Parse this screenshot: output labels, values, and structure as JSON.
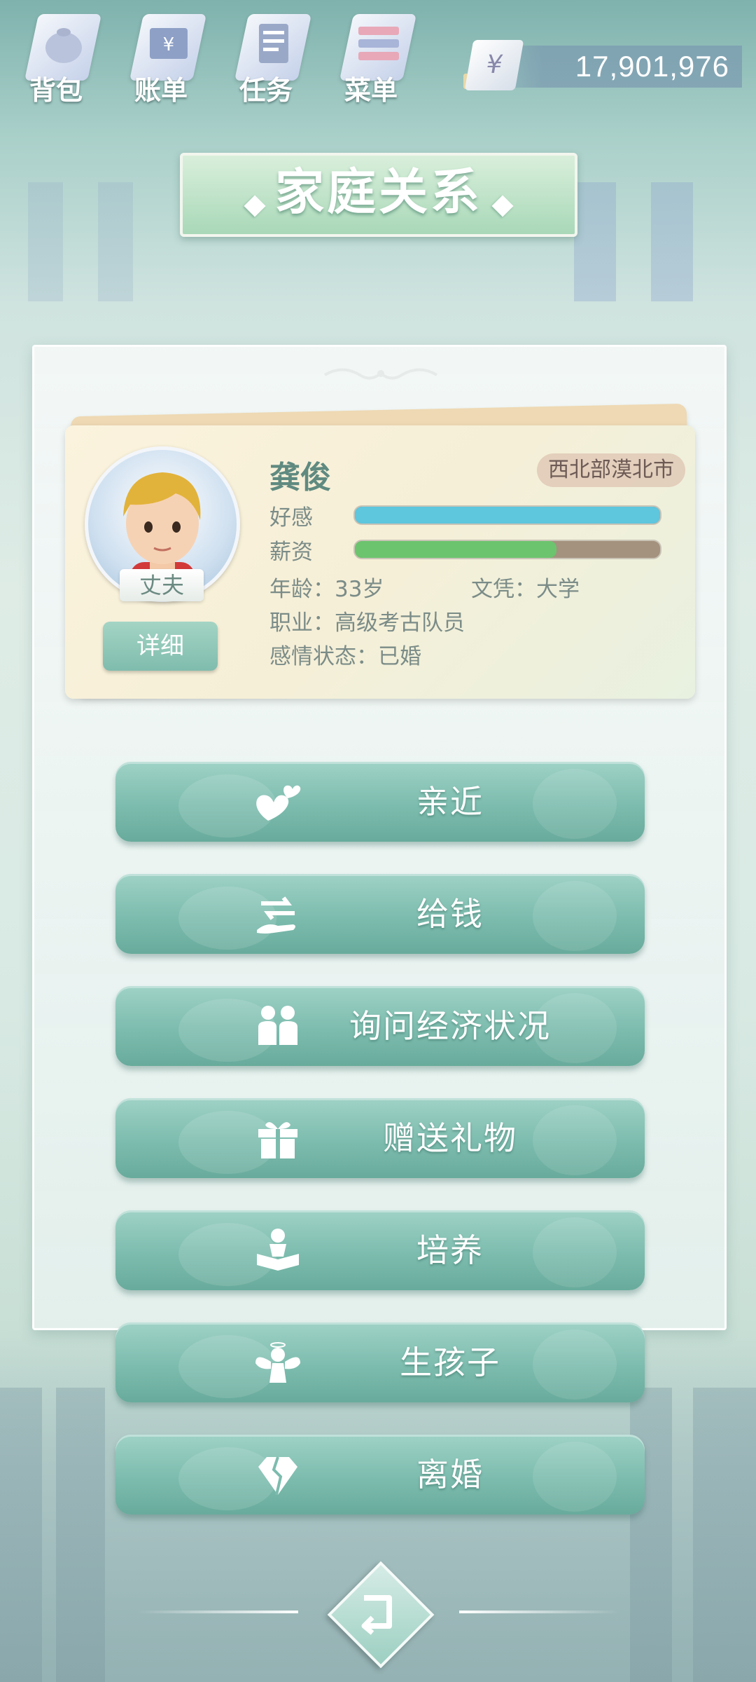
{
  "topbar": {
    "items": [
      {
        "label": "背包",
        "icon": "backpack-icon"
      },
      {
        "label": "账单",
        "icon": "bill-icon"
      },
      {
        "label": "任务",
        "icon": "task-icon"
      },
      {
        "label": "菜单",
        "icon": "menu-icon"
      }
    ],
    "currency_symbol": "¥",
    "money": "17,901,976"
  },
  "title": "家庭关系",
  "profile": {
    "name": "龚俊",
    "location": "西北部漠北市",
    "role": "丈夫",
    "detail_label": "详细",
    "affection_label": "好感",
    "affection_value": 1.0,
    "salary_label": "薪资",
    "salary_value": 0.66,
    "age": "年龄：33岁",
    "education": "文凭：大学",
    "occupation": "职业：高级考古队员",
    "relationship": "感情状态：已婚"
  },
  "actions": [
    {
      "label": "亲近",
      "icon": "hearts-icon"
    },
    {
      "label": "给钱",
      "icon": "give-money-icon"
    },
    {
      "label": "询问经济状况",
      "icon": "people-icon"
    },
    {
      "label": "赠送礼物",
      "icon": "gift-icon"
    },
    {
      "label": "培养",
      "icon": "reading-icon"
    },
    {
      "label": "生孩子",
      "icon": "angel-icon"
    },
    {
      "label": "离婚",
      "icon": "broken-diamond-icon"
    }
  ],
  "colors": {
    "affection_bar": "#5ec6dd",
    "salary_bar": "#6cc46e",
    "button_teal": "#7cbcae"
  }
}
